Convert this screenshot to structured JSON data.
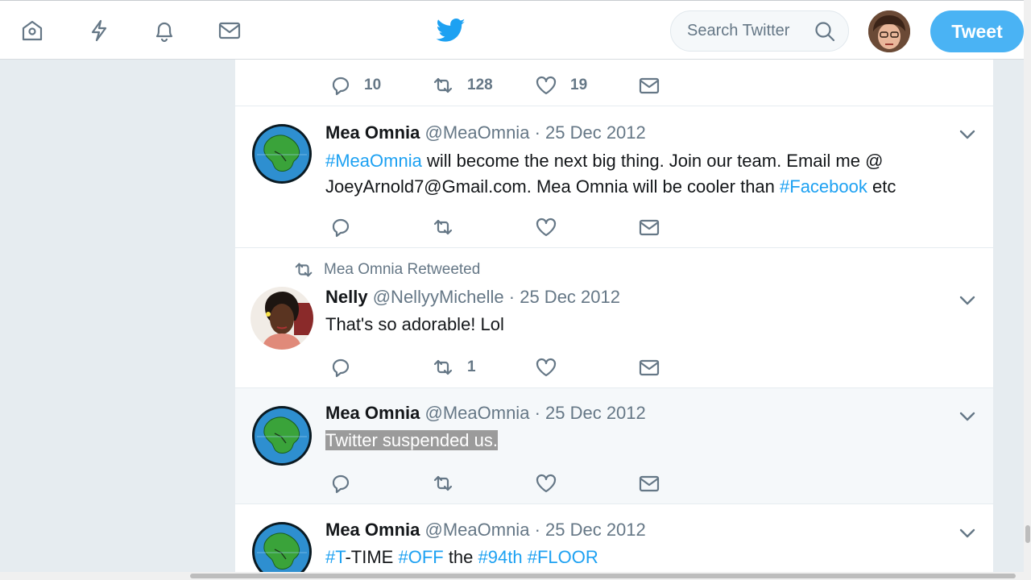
{
  "nav": {
    "items": [
      {
        "name": "home-icon"
      },
      {
        "name": "moments-icon"
      },
      {
        "name": "notifications-icon"
      },
      {
        "name": "messages-icon"
      }
    ]
  },
  "search": {
    "placeholder": "Search Twitter"
  },
  "tweet_button": "Tweet",
  "colors": {
    "accent": "#1da1f2",
    "button": "#4ab3f4",
    "muted": "#657786",
    "background": "#e6ecf0"
  },
  "tweets": [
    {
      "replies": "10",
      "retweets": "128",
      "likes": "19"
    },
    {
      "name": "Mea Omnia",
      "handle": "@MeaOmnia",
      "date": "· 25 Dec 2012",
      "text": [
        {
          "t": "#MeaOmnia",
          "tag": true
        },
        {
          "t": " will become the next big thing. Join our team. Email me @ JoeyArnold7@Gmail.com. Mea Omnia will be cooler than "
        },
        {
          "t": "#Facebook",
          "tag": true
        },
        {
          "t": " etc"
        }
      ]
    },
    {
      "retweet_context": "Mea Omnia Retweeted",
      "name": "Nelly",
      "handle": "@NellyyMichelle",
      "date": "· 25 Dec 2012",
      "text": "That's so adorable! Lol",
      "retweets": "1"
    },
    {
      "name": "Mea Omnia",
      "handle": "@MeaOmnia",
      "date": "· 25 Dec 2012",
      "text": "Twitter suspended us."
    },
    {
      "name": "Mea Omnia",
      "handle": "@MeaOmnia",
      "date": "· 25 Dec 2012",
      "text": [
        {
          "t": "#T",
          "tag": true
        },
        {
          "t": "-TIME "
        },
        {
          "t": "#OFF",
          "tag": true
        },
        {
          "t": " the "
        },
        {
          "t": "#94th",
          "tag": true
        },
        {
          "t": " "
        },
        {
          "t": "#FLOOR",
          "tag": true
        }
      ]
    }
  ]
}
